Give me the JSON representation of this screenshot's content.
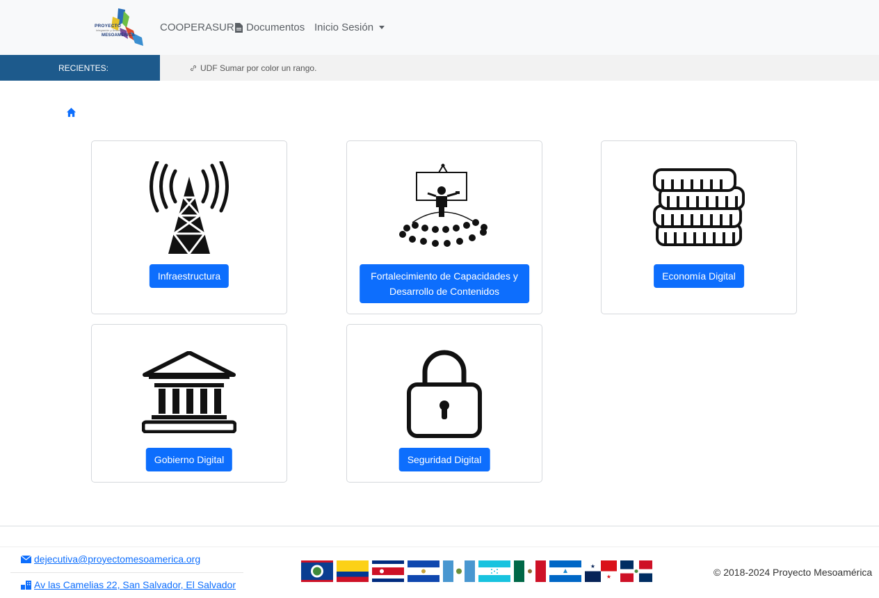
{
  "navbar": {
    "logo_text": [
      "PROYECTO",
      "Integración y Desarrollo",
      "MESOAMÉRICA"
    ],
    "links": [
      {
        "label": "COOPERASUR"
      },
      {
        "label": "Documentos",
        "icon": "document-icon"
      },
      {
        "label": "Inicio Sesión",
        "icon": "caret-down-icon"
      }
    ]
  },
  "recent": {
    "label": "RECIENTES:",
    "item": "UDF Sumar por color un rango.",
    "item_icon": "link-icon"
  },
  "breadcrumb": {
    "icon": "home-icon"
  },
  "cards": [
    {
      "button": "Infraestructura",
      "icon": "antenna-tower-icon"
    },
    {
      "button_line1": "Fortalecimiento de Capacidades y",
      "button_line2": "Desarrollo de Contenidos",
      "icon": "classroom-icon"
    },
    {
      "button": "Economía Digital",
      "icon": "coins-icon"
    },
    {
      "button": "Gobierno Digital",
      "icon": "government-building-icon"
    },
    {
      "button": "Seguridad Digital",
      "icon": "padlock-icon"
    }
  ],
  "footer": {
    "email": " dejecutiva@proyectomesoamerica.org",
    "address": " Av las Camelias 22, San Salvador, El Salvador",
    "flags": [
      "Belice",
      "Colombia",
      "Costa Rica",
      "El Salvador",
      "Guatemala",
      "Honduras",
      "México",
      "Nicaragua",
      "Panamá",
      "República Dominicana"
    ],
    "copyright": "© 2018-2024 Proyecto Mesoamérica"
  },
  "colors": {
    "primary": "#0d6efd",
    "recent_bar": "#1d5a8c",
    "navbar_bg": "#f8f9fa"
  }
}
